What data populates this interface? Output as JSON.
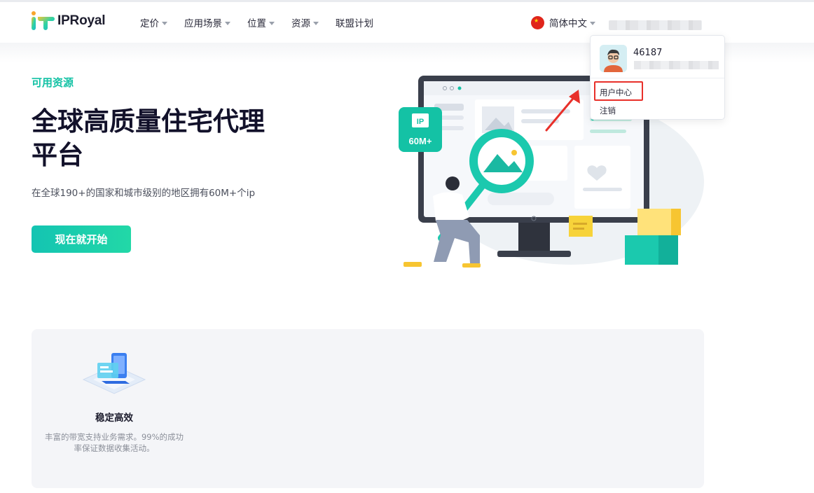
{
  "brand": {
    "name": "IPRoyal"
  },
  "nav": {
    "items": [
      {
        "label": "定价",
        "has_caret": true
      },
      {
        "label": "应用场景",
        "has_caret": true
      },
      {
        "label": "位置",
        "has_caret": true
      },
      {
        "label": "资源",
        "has_caret": true
      },
      {
        "label": "联盟计划",
        "has_caret": false
      }
    ]
  },
  "language": {
    "label": "简体中文",
    "flag": "china-flag-icon"
  },
  "user_menu": {
    "user_id": "46187",
    "items": [
      {
        "label": "用户中心",
        "highlighted": true
      },
      {
        "label": "注销",
        "highlighted": false
      }
    ]
  },
  "hero": {
    "tag": "可用资源",
    "title_line1": "全球高质量住宅代理",
    "title_line2": "平台",
    "subtitle": "在全球190+的国家和城市级别的地区拥有60M+个ip",
    "cta_label": "现在就开始",
    "badge_top": "IP",
    "badge_bottom": "60M+"
  },
  "features": [
    {
      "title": "稳定高效",
      "description": "丰富的带宽支持业务需求。99%的成功率保证数据收集活动。",
      "icon": "device-cards-icon"
    }
  ],
  "colors": {
    "accent": "#14c2a5",
    "highlight_box": "#e8302a",
    "title": "#12112a"
  }
}
